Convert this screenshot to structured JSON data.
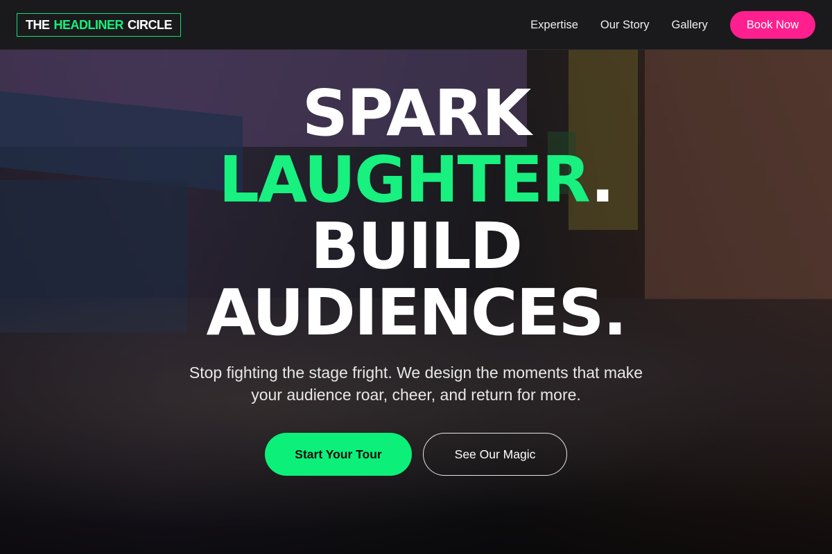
{
  "header": {
    "logo": {
      "part1": "THE",
      "part2": "HEADLINER",
      "part3": "CIRCLE"
    },
    "nav": [
      {
        "label": "Expertise"
      },
      {
        "label": "Our Story"
      },
      {
        "label": "Gallery"
      }
    ],
    "cta_label": "Book Now"
  },
  "hero": {
    "line1": "SPARK",
    "line2": "LAUGHTER",
    "line2_punct": ".",
    "line3": "BUILD",
    "line4": "AUDIENCES.",
    "subhead": "Stop fighting the stage fright. We design the moments that make your audience roar, cheer, and return for more.",
    "primary_cta": "Start Your Tour",
    "secondary_cta": "See Our Magic"
  },
  "colors": {
    "accent_green": "#18f07f",
    "accent_pink": "#ff1f8e",
    "header_bg": "#1a1a1c"
  }
}
